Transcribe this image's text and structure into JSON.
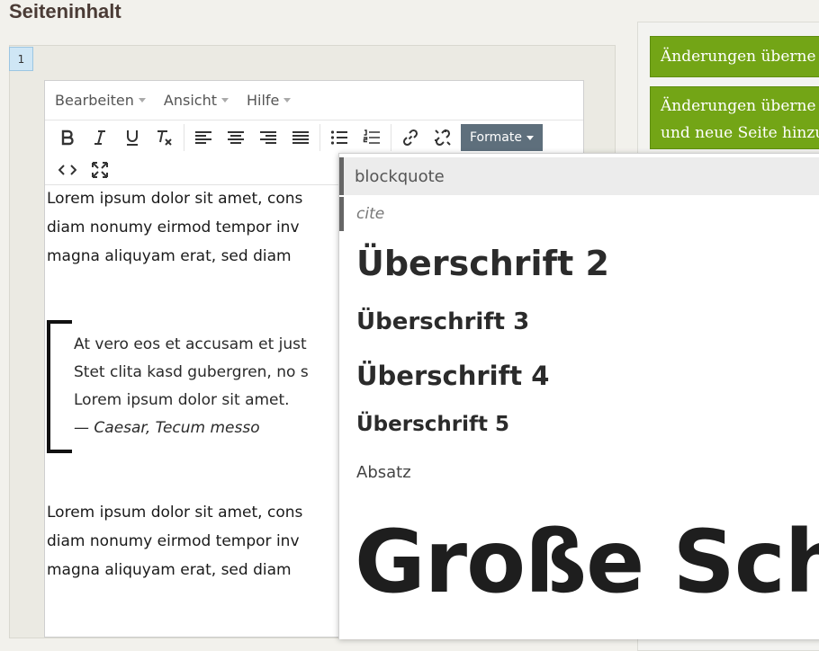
{
  "page": {
    "title": "Seiteninhalt"
  },
  "section": {
    "number": "1"
  },
  "editor": {
    "menubar": [
      {
        "label": "Bearbeiten"
      },
      {
        "label": "Ansicht"
      },
      {
        "label": "Hilfe"
      }
    ],
    "formats_button": "Formate",
    "content": {
      "para1": [
        "Lorem ipsum dolor sit amet, cons",
        "diam nonumy eirmod tempor inv",
        "magna aliquyam erat, sed diam"
      ],
      "blockquote": [
        "At vero eos et accusam et just",
        "Stet clita kasd gubergren, no s",
        "Lorem ipsum dolor sit amet."
      ],
      "blockquote_cite": "— Caesar, Tecum messo",
      "para2": [
        "Lorem ipsum dolor sit amet, cons",
        "diam nonumy eirmod tempor inv",
        "magna aliquyam erat, sed diam"
      ]
    }
  },
  "formats_menu": {
    "blockquote": "blockquote",
    "cite": "cite",
    "h2": "Überschrift 2",
    "h3": "Überschrift 3",
    "h4": "Überschrift 4",
    "h5": "Überschrift 5",
    "paragraph": "Absatz",
    "large": "Große Schr"
  },
  "side_panel": {
    "apply_button": "Änderungen überne",
    "apply_new_line1": "Änderungen überne",
    "apply_new_line2": "und neue Seite hinzu"
  },
  "colors": {
    "accent_green": "#73a516",
    "formats_button_bg": "#5e6f7c",
    "badge_bg": "#cfe6f5"
  },
  "icons": {
    "toolbar": [
      "bold-icon",
      "italic-icon",
      "underline-icon",
      "clear-format-icon",
      "align-left-icon",
      "align-center-icon",
      "align-right-icon",
      "align-justify-icon",
      "bullet-list-icon",
      "numbered-list-icon",
      "link-icon",
      "unlink-icon",
      "source-code-icon",
      "fullscreen-icon"
    ]
  }
}
